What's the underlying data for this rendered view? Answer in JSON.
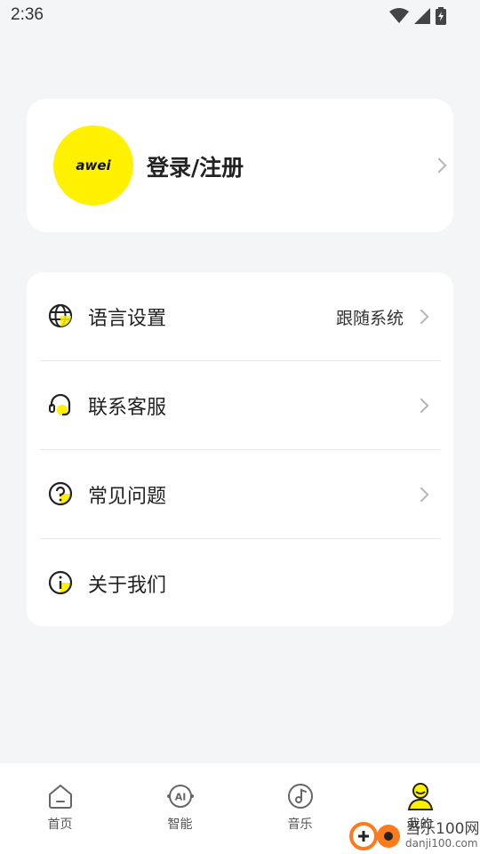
{
  "status_bar": {
    "time": "2:36",
    "icons": [
      "wifi-icon",
      "cellular-signal-icon",
      "battery-charging-icon"
    ]
  },
  "profile": {
    "avatar_logo": "awei",
    "login_label": "登录/注册"
  },
  "menu": {
    "items": [
      {
        "icon": "globe-icon",
        "label": "语言设置",
        "value": "跟随系统"
      },
      {
        "icon": "headset-icon",
        "label": "联系客服"
      },
      {
        "icon": "question-circle-icon",
        "label": "常见问题"
      },
      {
        "icon": "info-circle-icon",
        "label": "关于我们"
      }
    ]
  },
  "tab_bar": {
    "tabs": [
      {
        "icon": "home-icon",
        "label": "首页"
      },
      {
        "icon": "ai-icon",
        "label": "智能"
      },
      {
        "icon": "music-disc-icon",
        "label": "音乐"
      },
      {
        "icon": "user-icon",
        "label": "我的"
      }
    ],
    "active": "我的"
  },
  "watermark": {
    "text": "当乐100网",
    "url": "danji100.com"
  },
  "colors": {
    "accent": "#fff100",
    "background": "#f4f5f7",
    "card": "#ffffff"
  }
}
